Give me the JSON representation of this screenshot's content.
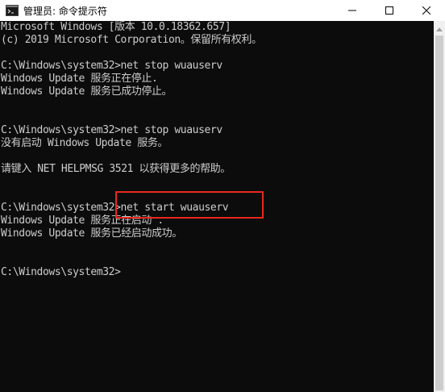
{
  "window": {
    "title": "管理员: 命令提示符",
    "controls": {
      "minimize_icon": "minimize-icon",
      "maximize_icon": "maximize-icon",
      "close_icon": "close-icon"
    }
  },
  "console": {
    "lines": [
      "Microsoft Windows [版本 10.0.18362.657]",
      "(c) 2019 Microsoft Corporation。保留所有权利。",
      "",
      "C:\\Windows\\system32>net stop wuauserv",
      "Windows Update 服务正在停止.",
      "Windows Update 服务已成功停止。",
      "",
      "",
      "C:\\Windows\\system32>net stop wuauserv",
      "没有启动 Windows Update 服务。",
      "",
      "请键入 NET HELPMSG 3521 以获得更多的帮助。",
      "",
      "",
      "C:\\Windows\\system32>net start wuauserv",
      "Windows Update 服务正在启动 .",
      "Windows Update 服务已经启动成功。",
      "",
      "",
      "C:\\Windows\\system32>"
    ]
  },
  "colors": {
    "console_bg": "#0c0c0c",
    "console_text": "#cccccc",
    "highlight": "#e8281f"
  }
}
